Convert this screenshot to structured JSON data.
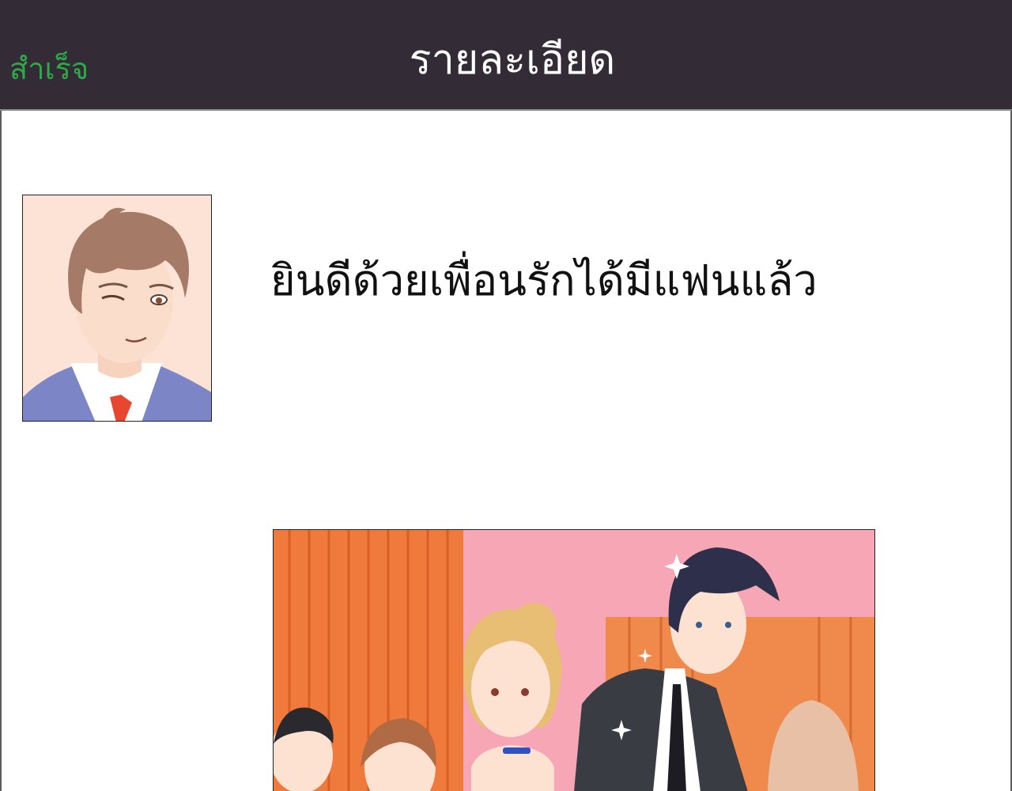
{
  "header": {
    "done_label": "สำเร็จ",
    "title": "รายละเอียด"
  },
  "colors": {
    "header_background": "#332b35",
    "done_text": "#2fa84a",
    "title_text": "#ffffff"
  },
  "message": {
    "text": "ยินดีด้วยเพื่อนรักได้มีแฟนแล้ว"
  },
  "icons": {
    "avatar": "smiling-man-avatar-icon",
    "scene": "party-scene-illustration"
  }
}
